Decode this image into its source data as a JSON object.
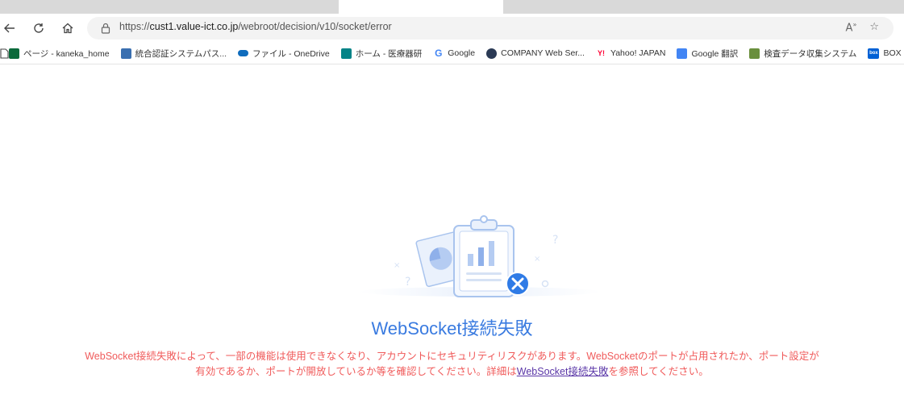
{
  "browser": {
    "url_prefix": "https://",
    "url_host": "cust1.value-ict.co.jp",
    "url_path": "/webroot/decision/v10/socket/error",
    "read_aloud_label": "A̒",
    "favorite_icon": "star-plus-icon"
  },
  "bookmarks": [
    {
      "label": "ページ - kaneka_home",
      "icon": "sharepoint-icon",
      "color": "#0b6a3b"
    },
    {
      "label": "統合認証システムパス...",
      "icon": "auth-icon",
      "color": "#3a6fb0"
    },
    {
      "label": "ファイル - OneDrive",
      "icon": "onedrive-icon",
      "color": "#0f6cbd"
    },
    {
      "label": "ホーム - 医療器研",
      "icon": "sharepoint-icon",
      "color": "#038387"
    },
    {
      "label": "Google",
      "icon": "google-icon",
      "color": "#4285f4"
    },
    {
      "label": "COMPANY Web Ser...",
      "icon": "company-icon",
      "color": "#2b3a55"
    },
    {
      "label": "Yahoo! JAPAN",
      "icon": "yahoo-icon",
      "color": "#ff0033"
    },
    {
      "label": "Google 翻訳",
      "icon": "translate-icon",
      "color": "#4285f4"
    },
    {
      "label": "検査データ収集システム",
      "icon": "chart-icon",
      "color": "#6a8f3d"
    },
    {
      "label": "BOX",
      "icon": "box-icon",
      "color": "#0061d5"
    }
  ],
  "main": {
    "title": "WebSocket接続失敗",
    "message_before": "WebSocket接続失敗によって、一部の機能は使用できなくなり、アカウントにセキュリティリスクがあります。WebSocketのポートが占用されたか、ポート設定が有効であるか、ポートが開放しているか等を確認してください。詳細は",
    "message_link": "WebSocket接続失敗",
    "message_after": "を参照してください。",
    "title_color": "#3a7be0",
    "message_color": "#f05b5b"
  }
}
